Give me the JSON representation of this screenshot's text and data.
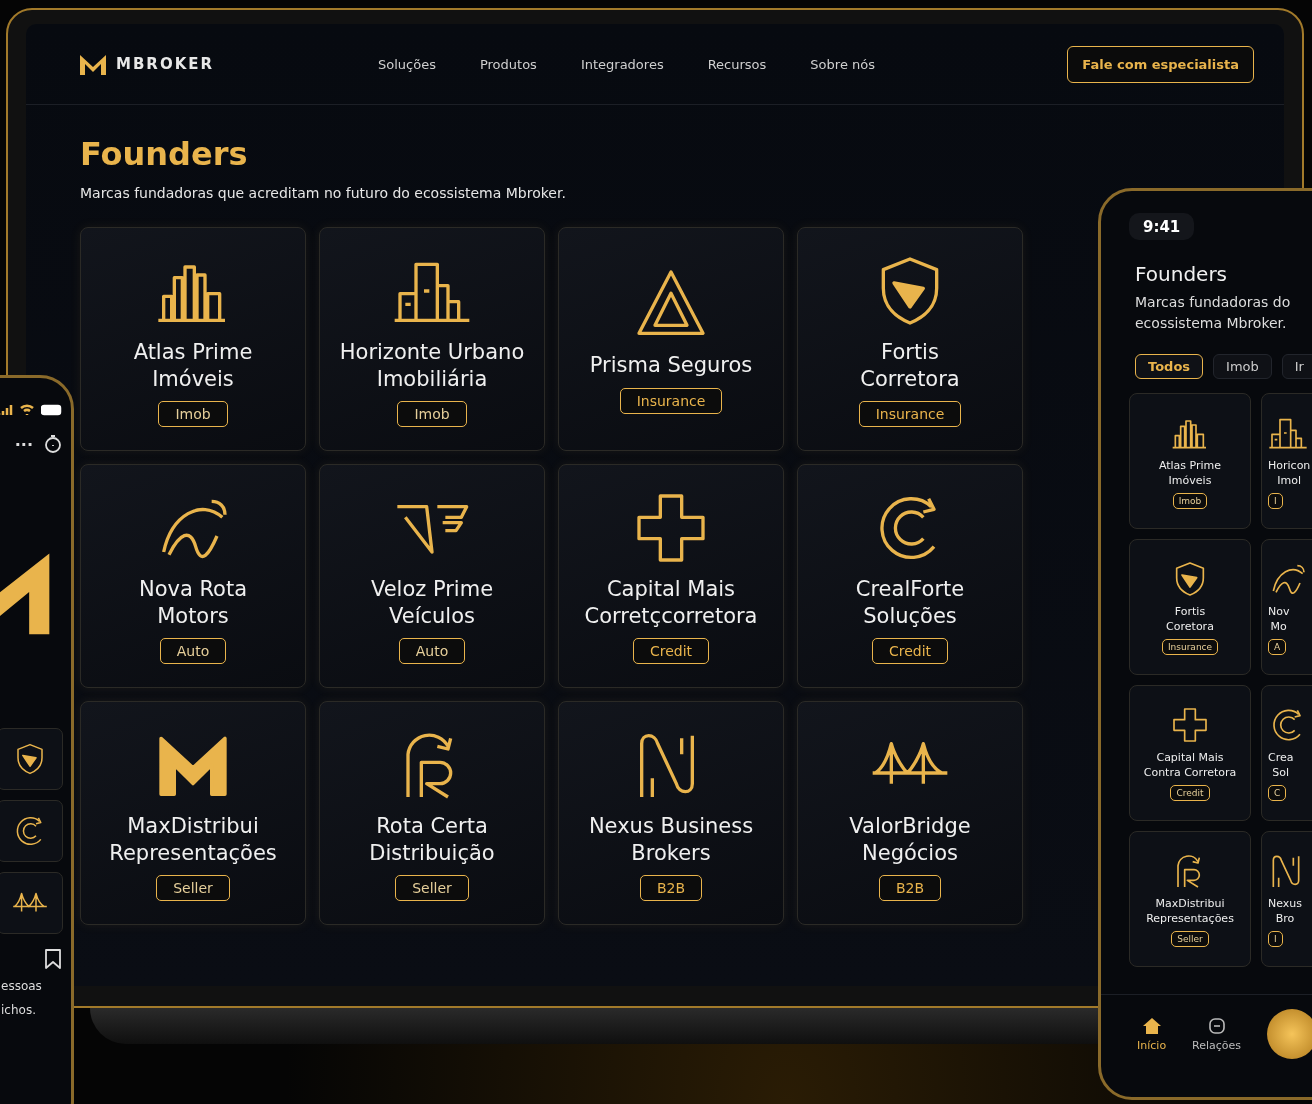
{
  "laptop": {
    "brand": "MBROKER",
    "nav": [
      "Soluções",
      "Produtos",
      "Integradores",
      "Recursos",
      "Sobre nós"
    ],
    "cta": "Fale com especialista",
    "title": "Founders",
    "subtitle": "Marcas fundadoras que acreditam no futuro do ecossistema Mbroker.",
    "cards": [
      {
        "lines": [
          "Atlas Prime",
          "Imóveis"
        ],
        "tag": "Imob"
      },
      {
        "lines": [
          "Horizonte Urbano",
          "Imobiliária"
        ],
        "tag": "Imob"
      },
      {
        "lines": [
          "Prisma Seguros"
        ],
        "tag": "Insurance"
      },
      {
        "lines": [
          "Fortis",
          "Corretora"
        ],
        "tag": "Insurance"
      },
      {
        "lines": [
          "Nova Rota",
          "Motors"
        ],
        "tag": "Auto"
      },
      {
        "lines": [
          "Veloz Prime",
          "Veículos"
        ],
        "tag": "Auto"
      },
      {
        "lines": [
          "Capital Mais",
          "Corretçcorretora"
        ],
        "tag": "Credit"
      },
      {
        "lines": [
          "CrealForte",
          "Soluções"
        ],
        "tag": "Credit"
      },
      {
        "lines": [
          "MaxDistribui",
          "Representações"
        ],
        "tag": "Seller"
      },
      {
        "lines": [
          "Rota Certa",
          "Distribuição"
        ],
        "tag": "Seller"
      },
      {
        "lines": [
          "Nexus Business",
          "Brokers"
        ],
        "tag": "B2B"
      },
      {
        "lines": [
          "ValorBridge",
          "Negócios"
        ],
        "tag": "B2B"
      }
    ]
  },
  "phone_left": {
    "menu": "···",
    "text_lines": [
      "essoas",
      "ichos."
    ]
  },
  "phone_right": {
    "time": "9:41",
    "title": "Founders",
    "subtitle": "Marcas fundadoras do ecossistema Mbroker.",
    "filters": [
      {
        "label": "Todos",
        "selected": true
      },
      {
        "label": "Imob",
        "selected": false
      },
      {
        "label": "Ir",
        "selected": false
      }
    ],
    "cards": [
      {
        "lines": [
          "Atlas Prime",
          "Imóveis"
        ],
        "tag": "Imob"
      },
      {
        "lines": [
          "Horicon",
          "Imol"
        ],
        "tag": "I"
      },
      {
        "lines": [
          "Fortis",
          "Coretora"
        ],
        "tag": "Insurance"
      },
      {
        "lines": [
          "Nov",
          "Mo"
        ],
        "tag": "A"
      },
      {
        "lines": [
          "Capital Mais",
          "Contra Corretora"
        ],
        "tag": "Credit"
      },
      {
        "lines": [
          "Crea",
          "Sol"
        ],
        "tag": "C"
      },
      {
        "lines": [
          "MaxDistribui",
          "Representações"
        ],
        "tag": "Seller"
      },
      {
        "lines": [
          "Nexus",
          "Bro"
        ],
        "tag": "I"
      }
    ],
    "nav": [
      {
        "label": "Início",
        "selected": true
      },
      {
        "label": "Relações",
        "selected": false
      }
    ]
  }
}
